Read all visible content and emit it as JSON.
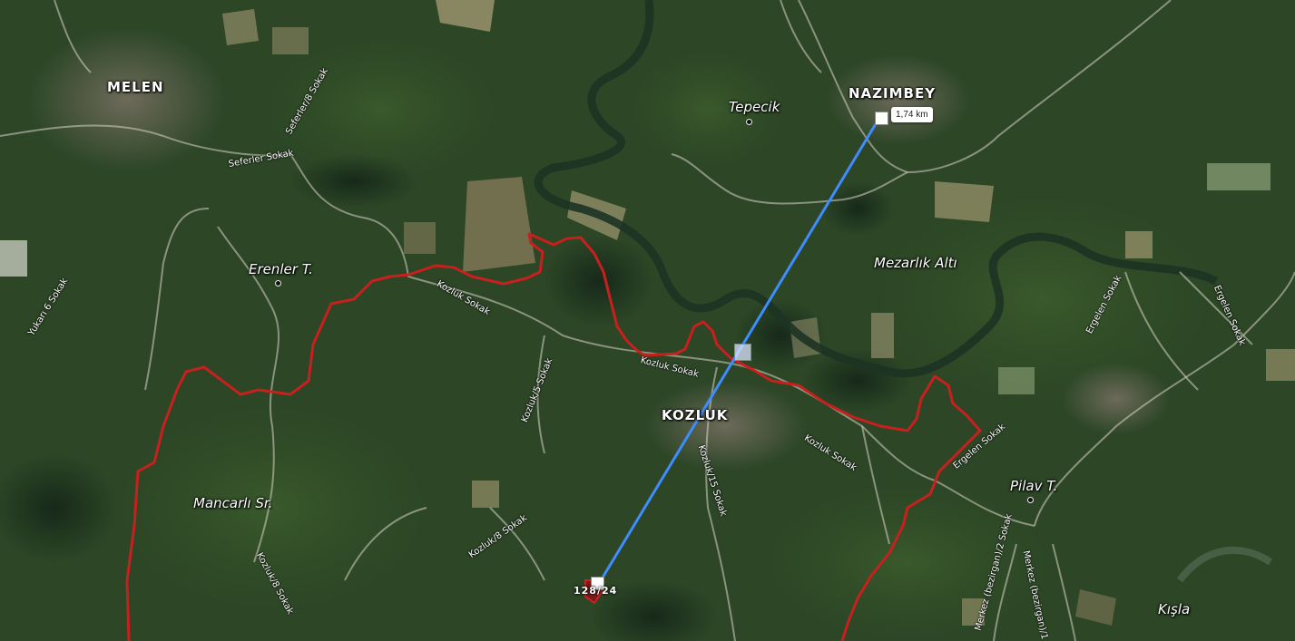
{
  "map": {
    "basemap": "satellite",
    "colors": {
      "boundary": "#c8201e",
      "measure_line": "#3f8cff",
      "road": "#d8d4c4"
    }
  },
  "places": {
    "melen": "MELEN",
    "nazimbey": "NAZIMBEY",
    "kozluk": "KOZLUK",
    "tepecik": "Tepecik",
    "erenler": "Erenler T.",
    "mezarlik": "Mezarlık Altı",
    "mancarli": "Mancarlı Sr.",
    "pilav": "Pilav T.",
    "kisla": "Kışla"
  },
  "streets": {
    "seferler": "Seferler Sokak",
    "seferler8": "Seferler/8 Sokak",
    "yukari6": "Yukarı 6 Sokak",
    "kozluk1": "Kozluk Sokak",
    "kozluk2": "Kozluk Sokak",
    "kozluk3": "Kozluk Sokak",
    "kozluk5": "Kozluk/5 Sokak",
    "kozluk15": "Kozluk/15 Sokak",
    "kozluk8a": "Kozluk/8 Sokak",
    "kozluk8b": "Kozluk/8 Sokak",
    "ergelen1": "Ergelen Sokak",
    "ergelen2": "Ergelen Sokak",
    "ergelen3": "Ergelen Sokak",
    "merkez2": "Merkez (bezirgan)/2 Sokak",
    "merkez1": "Merkez (bezirgan)/1 Sokak"
  },
  "measurement": {
    "distance": "1,74 km"
  },
  "parcel": {
    "label": "128/24"
  }
}
